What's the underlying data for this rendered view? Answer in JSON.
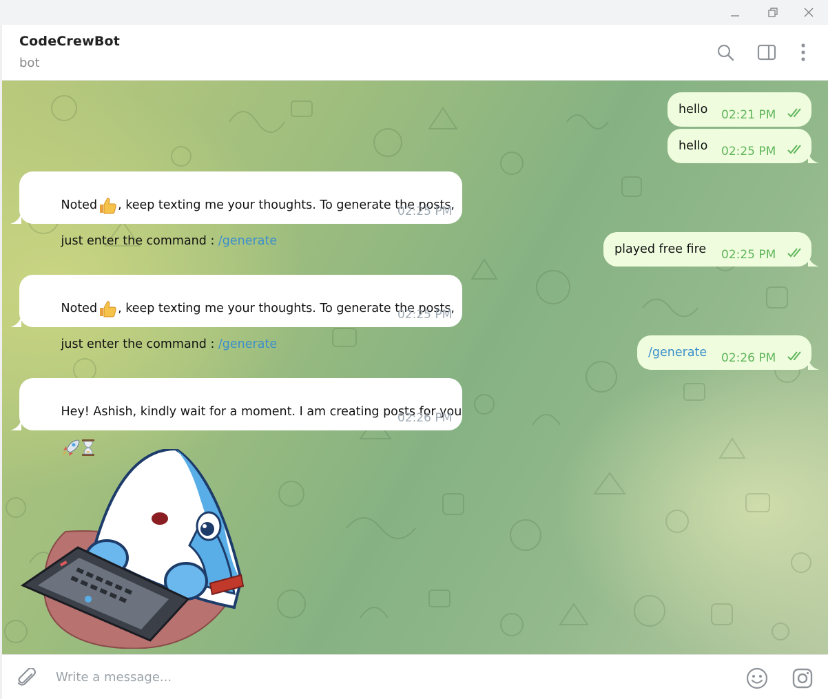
{
  "chat": {
    "title": "CodeCrewBot",
    "subtitle": "bot"
  },
  "icons": {
    "window_minimize": "minimize-icon",
    "window_restore": "restore-icon",
    "window_close": "close-icon",
    "search": "search-icon",
    "sidebar_toggle": "sidebar-toggle-icon",
    "more": "more-vertical-icon",
    "attach": "paperclip-icon",
    "emoji": "smiley-icon",
    "camera": "instagram-camera-icon"
  },
  "colors": {
    "outgoing_bubble": "#effdde",
    "incoming_bubble": "#ffffff",
    "link": "#3b8ecb",
    "outgoing_time": "#5fb45a",
    "incoming_time": "#a0abb5"
  },
  "messages": [
    {
      "direction": "out",
      "text": "hello",
      "time": "02:21 PM",
      "status": "read"
    },
    {
      "direction": "out",
      "text": "hello",
      "time": "02:25 PM",
      "status": "read"
    },
    {
      "direction": "in",
      "text_line1": "Noted",
      "text_line1_rest": ", keep texting me your thoughts. To generate the posts,",
      "text_line2": "just enter the command : ",
      "link": "/generate",
      "emoji": "thumbs-up",
      "time": "02:25 PM"
    },
    {
      "direction": "out",
      "text": "played free fire",
      "time": "02:25 PM",
      "status": "read"
    },
    {
      "direction": "in",
      "text_line1": "Noted",
      "text_line1_rest": ", keep texting me your thoughts. To generate the posts,",
      "text_line2": "just enter the command : ",
      "link": "/generate",
      "emoji": "thumbs-up",
      "time": "02:25 PM"
    },
    {
      "direction": "out",
      "text": "/generate",
      "time": "02:26 PM",
      "status": "read"
    },
    {
      "direction": "in",
      "text_line1": "Hey! Ashish, kindly wait for a moment. I am creating posts for you",
      "emojis": [
        "rocket",
        "hourglass"
      ],
      "time": "02:26 PM"
    }
  ],
  "sticker": {
    "name": "shark-typing-on-laptop-sticker"
  },
  "input": {
    "placeholder": "Write a message..."
  }
}
